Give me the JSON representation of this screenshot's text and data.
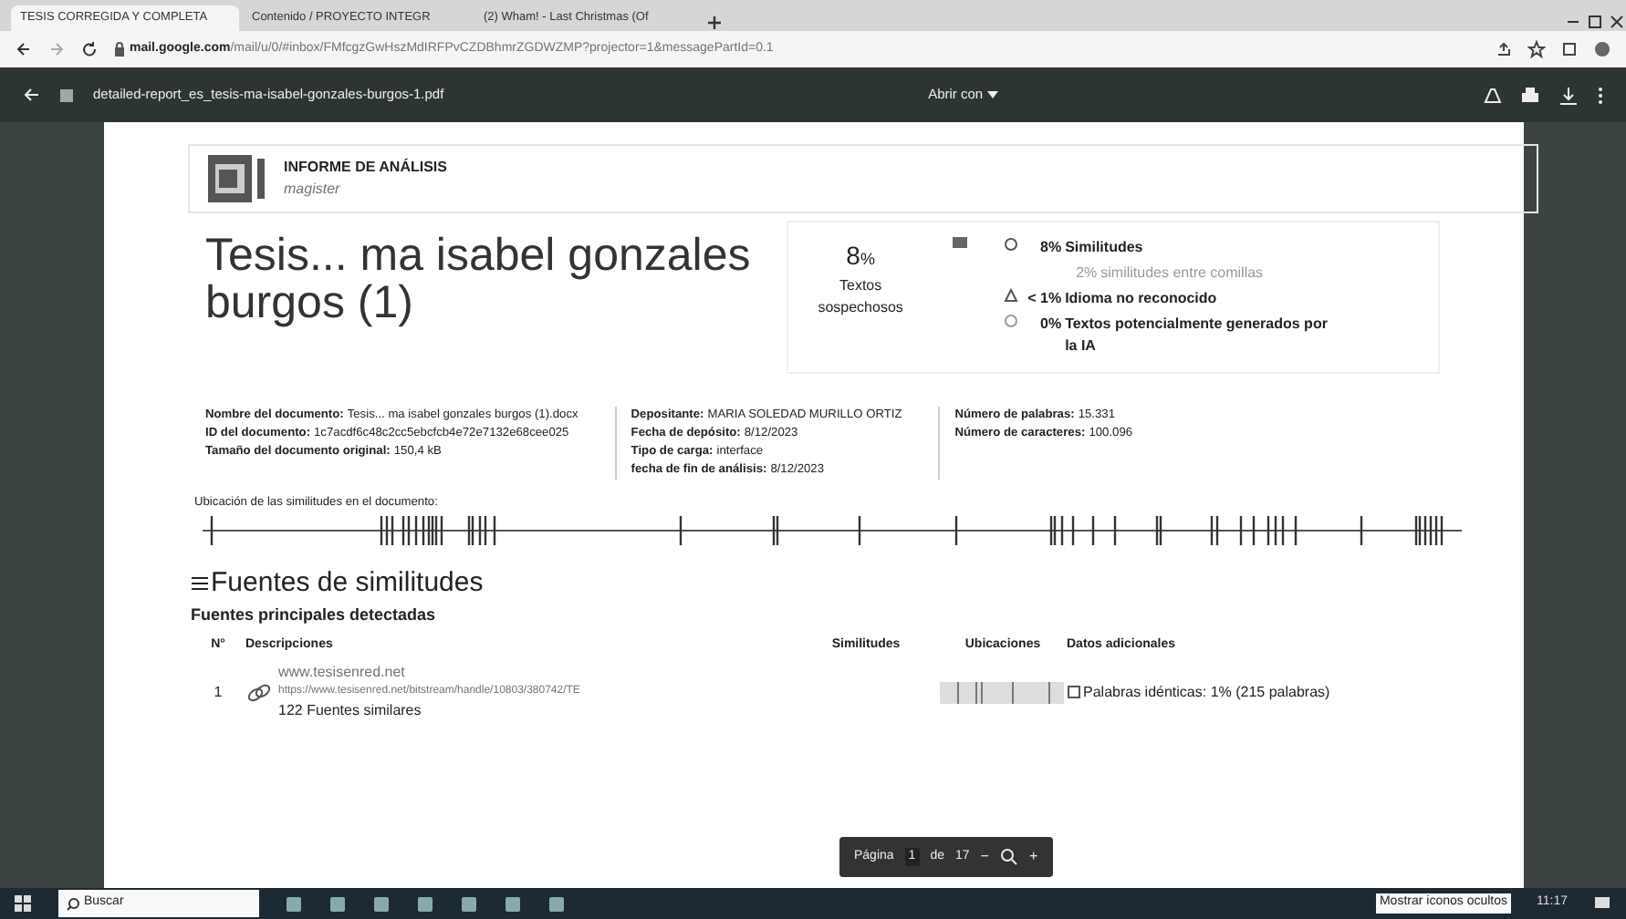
{
  "browser": {
    "tabs": [
      {
        "label": "TESIS CORREGIDA Y COMPLETA",
        "selected": true
      },
      {
        "label": "Contenido / PROYECTO INTEGR",
        "selected": false
      },
      {
        "label": "(2) Wham! - Last Christmas (Of",
        "selected": false
      }
    ],
    "address": {
      "domain": "mail.google.com",
      "path": "/mail/u/0/#inbox/FMfcgzGwHszMdIRFPvCZDBhmrZGDWZMP?projector=1&messagePartId=0.1"
    }
  },
  "viewer": {
    "filename": "detailed-report_es_tesis-ma-isabel-gonzales-burgos-1.pdf",
    "open_with": "Abrir con"
  },
  "report": {
    "header_title": "INFORME DE ANÁLISIS",
    "header_subtitle": "magister",
    "title": "Tesis... ma isabel gonzales burgos (1)",
    "score": {
      "value": "8",
      "unit": "%",
      "label": "Textos sospechosos"
    },
    "breakdown": [
      {
        "kind": "main",
        "pct": "8%",
        "label": "Similitudes"
      },
      {
        "kind": "sub",
        "pct": "2%",
        "label": "similitudes entre comillas"
      },
      {
        "kind": "main",
        "pct": "< 1%",
        "label": "Idioma no reconocido"
      },
      {
        "kind": "main",
        "pct": "0%",
        "label": "Textos potencialmente generados por la IA"
      }
    ],
    "info_columns": [
      [
        {
          "label": "Nombre del documento:",
          "value": "Tesis... ma isabel gonzales burgos (1).docx"
        },
        {
          "label": "ID del documento:",
          "value": "1c7acdf6c48c2cc5ebcfcb4e72e7132e68cee025"
        },
        {
          "label": "Tamaño del documento original:",
          "value": "150,4 kB"
        }
      ],
      [
        {
          "label": "Depositante:",
          "value": "MARIA SOLEDAD MURILLO ORTIZ"
        },
        {
          "label": "Fecha de depósito:",
          "value": "8/12/2023"
        },
        {
          "label": "Tipo de carga:",
          "value": "interface"
        },
        {
          "label": "fecha de fin de análisis:",
          "value": "8/12/2023"
        }
      ],
      [
        {
          "label": "Número de palabras:",
          "value": "15.331"
        },
        {
          "label": "Número de caracteres:",
          "value": "100.096"
        }
      ]
    ],
    "locations_label": "Ubicación de las similitudes en el documento:",
    "sources_heading": "Fuentes de similitudes",
    "sources_subheading": "Fuentes principales detectadas",
    "table": {
      "columns": [
        "N°",
        "Descripciones",
        "Similitudes",
        "Ubicaciones",
        "Datos adicionales"
      ],
      "rows": [
        {
          "n": "1",
          "site": "www.tesisenred.net",
          "url": "https://www.tesisenred.net/bitstream/handle/10803/380742/TE",
          "similar": "122 Fuentes similares",
          "extra": "Palabras idénticas: 1% (215 palabras)"
        }
      ]
    }
  },
  "page_controls": {
    "label": "Página",
    "page": "1",
    "of": "de",
    "total": "17",
    "minus": "−",
    "plus": "+"
  },
  "taskbar": {
    "search": "Buscar",
    "time": "11:17",
    "tooltip": "Mostrar iconos ocultos"
  }
}
